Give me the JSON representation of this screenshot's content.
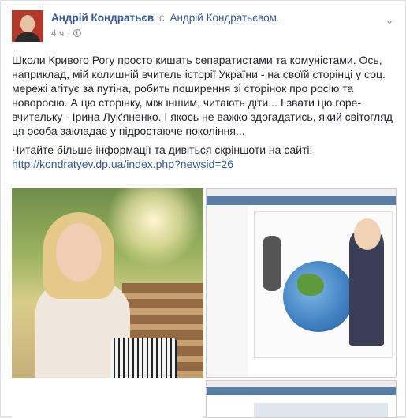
{
  "post": {
    "author": "Андрій Кондратьєв",
    "with_word": "с",
    "tagged": "Андрій Кондратьєвом.",
    "time": "4 ч",
    "paragraphs": [
      "Школи Кривого Рогу просто кишать сепаратистами та комуністами. Ось, наприклад, мій колишній вчитель історії України - на своїй сторінці у соц. мережі агітує за путіна, робить поширення зі сторінок про росію та новоросію. А цю сторінку, між іншим, читають діти... І звати цю горе-вчительку - Ірина Лук'яненко. І якось не важко здогадатись, який світогляд ця особа закладає у підростаюче покоління..."
    ],
    "read_more": "Читайте більше інформації та дивіться скріншоти на сайті:",
    "link": "http://kondratyev.dp.ua/index.php?newsid=26"
  },
  "icons": {
    "globe": "globe-icon",
    "chevron": "chevron-down-icon"
  },
  "colors": {
    "link": "#365899",
    "muted": "#90949c",
    "text": "#1d2129"
  }
}
